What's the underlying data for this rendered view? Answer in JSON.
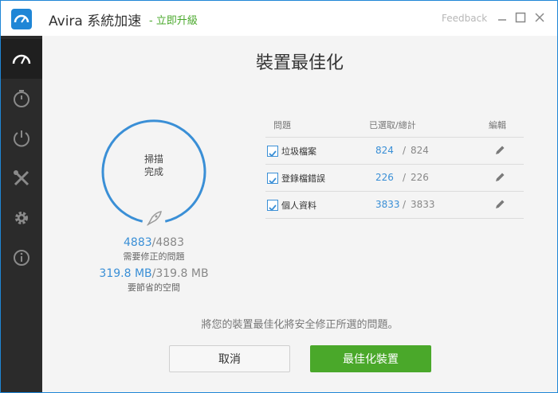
{
  "titlebar": {
    "title": "Avira 系統加速",
    "upgrade": "- 立即升級",
    "feedback": "Feedback"
  },
  "colors": {
    "accent": "#1f86d6",
    "green": "#4aa82a",
    "progress": "#3a8fd6",
    "sidebar": "#2b2b2b"
  },
  "sidebar": {
    "items": [
      {
        "icon": "speedometer-icon",
        "active": true
      },
      {
        "icon": "stopwatch-icon",
        "active": false
      },
      {
        "icon": "power-icon",
        "active": false
      },
      {
        "icon": "tools-icon",
        "active": false
      },
      {
        "icon": "gear-icon",
        "active": false
      },
      {
        "icon": "info-icon",
        "active": false
      }
    ]
  },
  "main": {
    "title": "裝置最佳化",
    "gauge": {
      "line1": "掃描",
      "line2": "完成",
      "icon": "rocket-icon"
    },
    "issues": {
      "value": "4883",
      "total": "4883",
      "label": "需要修正的問題"
    },
    "space": {
      "value": "319.8 MB",
      "total": "319.8 MB",
      "label": "要節省的空間"
    },
    "table": {
      "headers": {
        "issue": "問題",
        "selected": "已選取/總計",
        "edit": "編輯"
      },
      "rows": [
        {
          "label": "垃圾檔案",
          "selected": "824",
          "total": "824",
          "checked": true
        },
        {
          "label": "登錄檔錯誤",
          "selected": "226",
          "total": "226",
          "checked": true
        },
        {
          "label": "個人資料",
          "selected": "3833",
          "total": "3833",
          "checked": true
        }
      ]
    },
    "note": "將您的裝置最佳化將安全修正所選的問題。",
    "cancel_label": "取消",
    "optimize_label": "最佳化裝置"
  }
}
